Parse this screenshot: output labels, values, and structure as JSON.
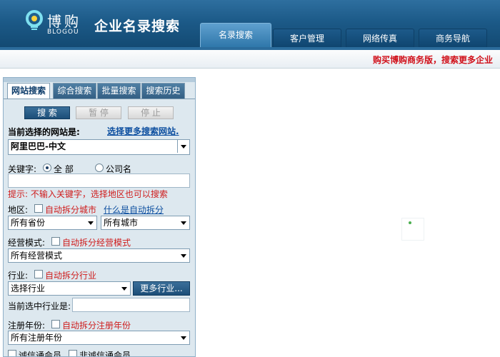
{
  "header": {
    "logo_cn": "博购",
    "logo_en": "BLOGOU",
    "title": "企业名录搜索",
    "nav": [
      {
        "label": "名录搜索"
      },
      {
        "label": "客户管理"
      },
      {
        "label": "网络传真"
      },
      {
        "label": "商务导航"
      }
    ]
  },
  "promo": "购买博购商务版，搜索更多企业",
  "panel": {
    "tabs": [
      "网站搜索",
      "综合搜索",
      "批量搜索",
      "搜索历史"
    ],
    "buttons": {
      "search": "搜 索",
      "pause": "暂 停",
      "stop": "停 止"
    },
    "site_label": "当前选择的网站是:",
    "more_sites_link": "选择更多搜索网站.",
    "site_value": "阿里巴巴-中文",
    "keyword_label": "关键字:",
    "radio_all": "全 部",
    "radio_company": "公司名",
    "keyword_value": "",
    "hint": "提示: 不输入关键字，选择地区也可以搜索",
    "region_label": "地区:",
    "auto_split_city": "自动拆分城市",
    "what_is_split": "什么是自动拆分",
    "province": "所有省份",
    "city": "所有城市",
    "mode_label": "经营模式:",
    "auto_split_mode": "自动拆分经营模式",
    "mode_value": "所有经营模式",
    "industry_label": "行业:",
    "auto_split_industry": "自动拆分行业",
    "industry_value": "选择行业",
    "more_industry": "更多行业...",
    "current_industry_label": "当前选中行业是:",
    "current_industry_value": "",
    "reg_year_label": "注册年份:",
    "auto_split_year": "自动拆分注册年份",
    "reg_year_value": "所有注册年份",
    "trust_member": "诚信通会员",
    "non_trust_member": "非诚信通会员"
  }
}
